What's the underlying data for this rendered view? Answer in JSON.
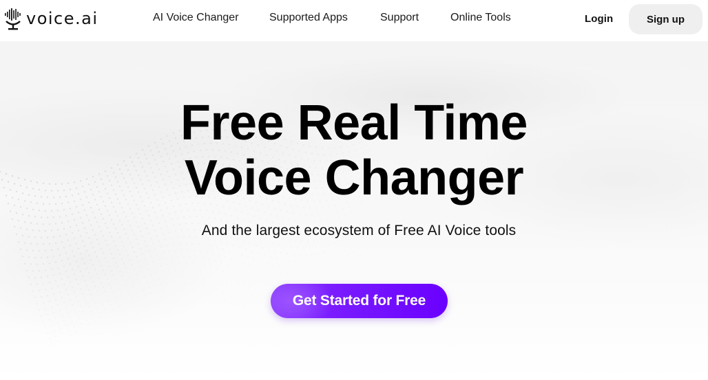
{
  "brand": {
    "name": "voice.ai",
    "logo_icon": "microphone-waveform-icon"
  },
  "nav": {
    "items": [
      {
        "label": "AI Voice Changer"
      },
      {
        "label": "Supported Apps"
      },
      {
        "label": "Support"
      },
      {
        "label": "Online Tools"
      }
    ],
    "login_label": "Login",
    "signup_label": "Sign up"
  },
  "hero": {
    "title_line1": "Free Real Time",
    "title_line2": "Voice Changer",
    "subtitle": "And the largest ecosystem of Free AI Voice tools",
    "cta_label": "Get Started for Free"
  },
  "colors": {
    "cta_start": "#8a3dff",
    "cta_end": "#6a00ff",
    "signup_bg": "#efefef",
    "text": "#111111"
  }
}
